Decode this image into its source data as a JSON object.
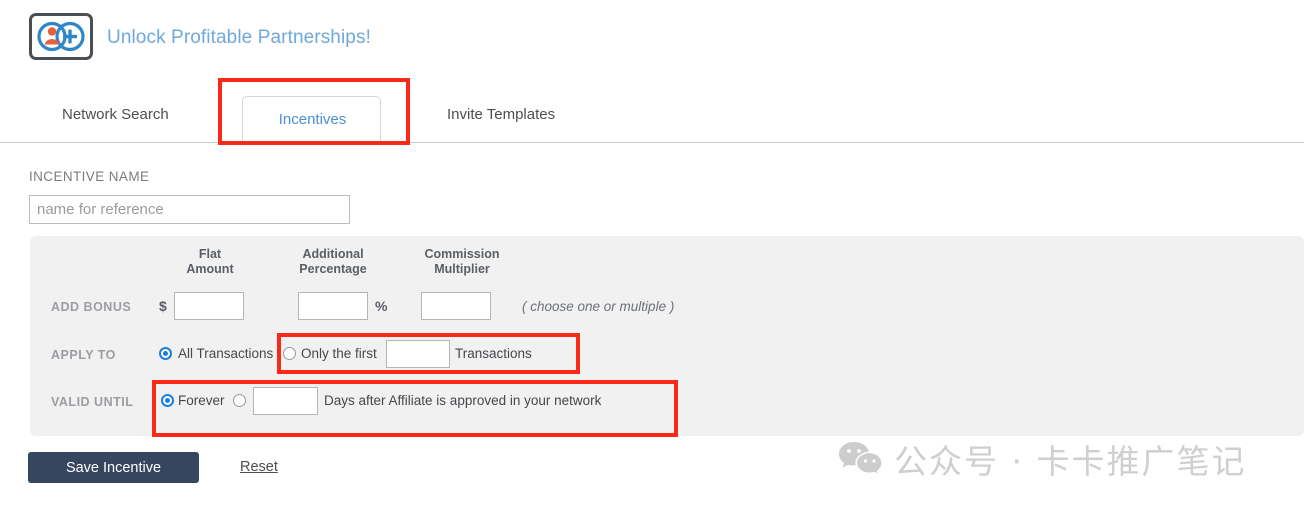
{
  "header": {
    "title": "Unlock Profitable Partnerships!",
    "logo_icon": "person-plus-icon"
  },
  "tabs": {
    "items": [
      {
        "label": "Network Search",
        "active": false
      },
      {
        "label": "Incentives",
        "active": true
      },
      {
        "label": "Invite Templates",
        "active": false
      }
    ]
  },
  "form": {
    "incentive_name": {
      "label": "INCENTIVE NAME",
      "value": "",
      "placeholder": "name for reference"
    },
    "columns": [
      {
        "heading": "Flat\nAmount"
      },
      {
        "heading": "Additional\nPercentage"
      },
      {
        "heading": "Commission\nMultiplier"
      }
    ],
    "add_bonus": {
      "label": "ADD BONUS",
      "dollar_symbol": "$",
      "percent_symbol": "%",
      "flat_amount": "",
      "additional_percentage": "",
      "commission_multiplier": "",
      "hint": "( choose one or multiple )"
    },
    "apply_to": {
      "label": "APPLY TO",
      "option_all": "All Transactions",
      "option_first": "Only the first",
      "transactions_suffix": "Transactions",
      "first_count": "",
      "selected": "all"
    },
    "valid_until": {
      "label": "VALID UNTIL",
      "option_forever": "Forever",
      "days_value": "",
      "days_suffix": "Days after Affiliate is approved in your network",
      "selected": "forever"
    }
  },
  "footer": {
    "save_label": "Save Incentive",
    "reset_label": "Reset"
  },
  "watermark": {
    "icon": "wechat-icon",
    "text": "公众号 · 卡卡推广笔记"
  },
  "colors": {
    "accent_blue": "#4a90d9",
    "title_blue": "#6fa8dc",
    "radio_blue": "#1b7fe0",
    "save_navy": "#36465e",
    "panel_grey": "#f1f1f1",
    "annotation_red": "#fb2a18",
    "logo_orange": "#e8603c"
  }
}
